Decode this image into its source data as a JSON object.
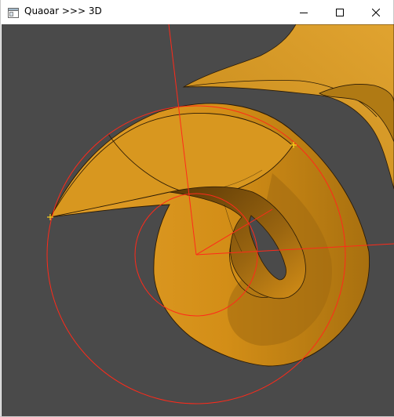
{
  "window": {
    "title": "Quaoar >>> 3D",
    "app_icon": "window-app-icon"
  },
  "caption_buttons": {
    "minimize_icon": "minimize-icon",
    "maximize_icon": "maximize-icon",
    "close_icon": "close-icon"
  },
  "viewport": {
    "background": "#4a4a4a",
    "surface_color": "#d9981f",
    "surface_shadow_color": "#7a4f0a",
    "overlay_color": "#ff2a1a",
    "marker_color": "#ffd21a",
    "edge_color": "#2a1a05"
  }
}
